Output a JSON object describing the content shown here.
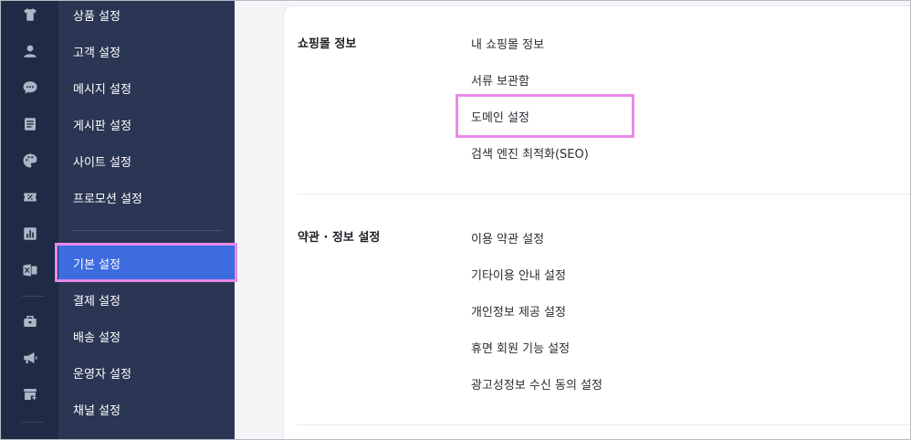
{
  "sidebar_icons": [
    {
      "name": "shirt-icon"
    },
    {
      "name": "user-icon"
    },
    {
      "name": "chat-icon"
    },
    {
      "name": "board-icon"
    },
    {
      "name": "palette-icon"
    },
    {
      "name": "percent-ticket-icon"
    },
    {
      "name": "bar-chart-icon"
    },
    {
      "name": "excel-icon"
    },
    {
      "name": "store-settings-icon"
    },
    {
      "name": "megaphone-icon"
    },
    {
      "name": "add-store-icon"
    }
  ],
  "subnav": {
    "items": [
      {
        "label": "상품 설정"
      },
      {
        "label": "고객 설정"
      },
      {
        "label": "메시지 설정"
      },
      {
        "label": "게시판 설정"
      },
      {
        "label": "사이트 설정"
      },
      {
        "label": "프로모션 설정"
      },
      {
        "label": "기본 설정",
        "active": true
      },
      {
        "label": "결제 설정"
      },
      {
        "label": "배송 설정"
      },
      {
        "label": "운영자 설정"
      },
      {
        "label": "채널 설정"
      }
    ]
  },
  "main": {
    "sections": [
      {
        "title": "쇼핑몰 정보",
        "links": [
          "내 쇼핑몰 정보",
          "서류 보관함",
          "도메인 설정",
          "검색 엔진 최적화(SEO)"
        ]
      },
      {
        "title": "약관 · 정보 설정",
        "links": [
          "이용 약관 설정",
          "기타이용 안내 설정",
          "개인정보 제공 설정",
          "휴면 회원 기능 설정",
          "광고성정보 수신 동의 설정"
        ]
      }
    ]
  },
  "colors": {
    "icon_bar_bg": "#1f2a44",
    "subnav_bg": "#2b3654",
    "active_item_bg": "#3d6ce0",
    "highlight_border": "#e88ae8"
  }
}
